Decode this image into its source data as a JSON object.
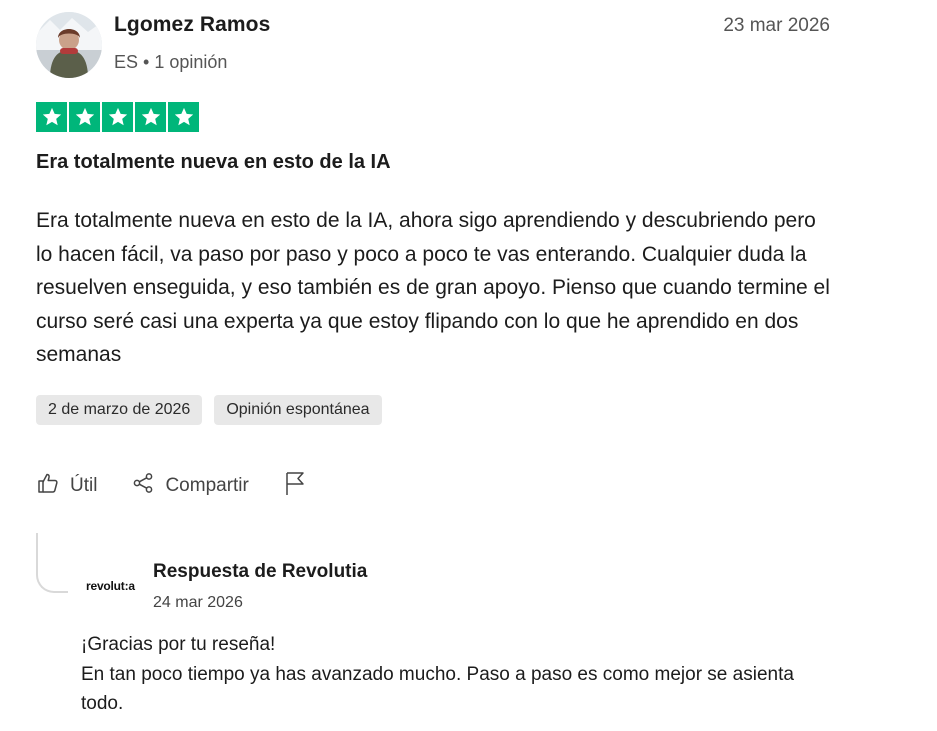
{
  "review": {
    "reviewer_name": "Lgomez Ramos",
    "reviewer_meta": "ES • 1 opinión",
    "date": "23 mar 2026",
    "rating": 5,
    "star_color": "#00b67a",
    "title": "Era totalmente nueva en esto de la IA",
    "body": "Era totalmente nueva en esto de la IA, ahora sigo aprendiendo y descubriendo pero lo hacen fácil, va paso por paso y poco a poco te vas enterando. Cualquier duda la resuelven enseguida, y eso también es de gran apoyo. Pienso que cuando termine el curso seré casi una experta ya que estoy flipando con lo que he aprendido en dos semanas",
    "experience_date": "2 de marzo de 2026",
    "review_type": "Opinión espontánea"
  },
  "actions": {
    "useful_label": "Útil",
    "share_label": "Compartir",
    "useful_icon": "thumbs-up-icon",
    "share_icon": "share-icon",
    "flag_icon": "flag-icon"
  },
  "reply": {
    "logo_text": "revolut:a",
    "heading": "Respuesta de Revolutia",
    "date": "24 mar 2026",
    "line1": "¡Gracias por tu reseña!",
    "line2": "En tan poco tiempo ya has avanzado mucho. Paso a paso es como mejor se asienta todo."
  }
}
